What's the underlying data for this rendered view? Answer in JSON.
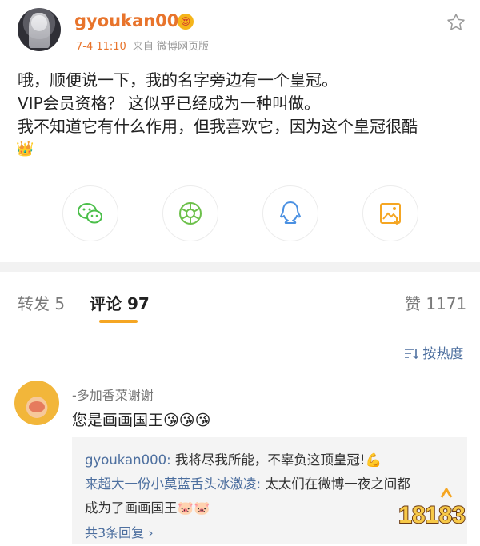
{
  "post": {
    "username": "gyoukan000",
    "badge_icon": "crown-smiley-badge-icon",
    "time": "7-4 11:10",
    "source": "来自 微博网页版",
    "lines": [
      "哦，顺便说一下，我的名字旁边有一个皇冠。",
      "VIP会员资格？ 这似乎已经成为一种叫做。",
      "我不知道它有什么作用，但我喜欢它，因为这个皇冠很酷"
    ],
    "trailing_emoji": "👑"
  },
  "share_buttons": [
    {
      "name": "wechat-icon",
      "color": "#4cbf4b"
    },
    {
      "name": "moments-icon",
      "color": "#6cc04a"
    },
    {
      "name": "qq-icon",
      "color": "#4a90e2"
    },
    {
      "name": "save-image-icon",
      "color": "#f5a623"
    }
  ],
  "tabs": {
    "repost": "转发 5",
    "comments": "评论 97",
    "likes": "赞 1171"
  },
  "sort": {
    "label": "按热度",
    "icon": "sort-icon"
  },
  "comment": {
    "user": "-多加香菜谢谢",
    "text": "您是画画国王😘😘😘",
    "replies": [
      {
        "name": "gyoukan000:",
        "text": " 我将尽我所能，不辜负这顶皇冠!💪"
      },
      {
        "name": "来超大一份小莫蓝舌头冰激凌:",
        "text": " 太太们在微博一夜之间都"
      },
      {
        "name": "",
        "text": "成为了画画国王🐷🐷"
      }
    ],
    "more_replies": "共3条回复 ›"
  },
  "watermark": "18183",
  "colors": {
    "username": "#e8742c",
    "link": "#4d6f9f",
    "accent": "#f5a623"
  }
}
